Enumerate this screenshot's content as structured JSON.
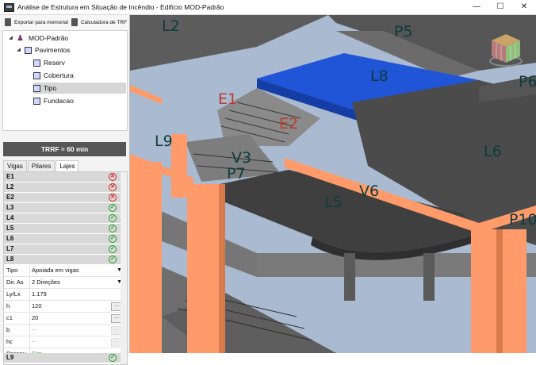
{
  "window": {
    "title": "Análise de Estrutura em Situação de Incêndio - Edifício MOD-Padrão",
    "controls": [
      "—",
      "☐",
      "✕"
    ]
  },
  "toolbar": {
    "export_label": "Exportar para memorial",
    "trrf_calc_label": "Calculadora de TRF"
  },
  "tree": {
    "root": "MOD-Padrão",
    "group": "Pavimentos",
    "items": [
      "Reserv",
      "Cobertura",
      "Tipo",
      "Fundacao"
    ],
    "selected": "Tipo"
  },
  "trrf_banner": "TRRF = 60 min",
  "tabs": [
    "Vigas",
    "Pilares",
    "Lajes"
  ],
  "active_tab": "Lajes",
  "slabs": [
    {
      "id": "E1",
      "status": "fail"
    },
    {
      "id": "L2",
      "status": "fail"
    },
    {
      "id": "E2",
      "status": "fail"
    },
    {
      "id": "L3",
      "status": "ok"
    },
    {
      "id": "L4",
      "status": "ok"
    },
    {
      "id": "L5",
      "status": "ok"
    },
    {
      "id": "L6",
      "status": "ok"
    },
    {
      "id": "L7",
      "status": "ok"
    },
    {
      "id": "L8",
      "status": "ok",
      "expanded": true
    }
  ],
  "l8_props": {
    "tipo_label": "Tipo",
    "tipo_value": "Apoiada em vigas",
    "dir_label": "Dir. As",
    "dir_value": "2 Direções",
    "lylx_label": "Ly/Lx",
    "lylx_value": "1.179",
    "h_label": "h",
    "h_value": "120",
    "c1_label": "c1",
    "c1_value": "20",
    "b_label": "b",
    "b_value": "--",
    "hc_label": "hc",
    "hc_value": "--",
    "passou_label": "Passou",
    "passou_value": "Sim"
  },
  "last_row": {
    "id": "L9",
    "status": "ok"
  },
  "viewport_labels": {
    "l2": "L2",
    "p5": "P5",
    "l8": "L8",
    "p6": "P6",
    "e1": "E1",
    "e2": "E2",
    "l9": "L9",
    "v3": "V3",
    "p7": "P7",
    "l6": "L6",
    "v6": "V6",
    "l5": "L5",
    "p10": "P10"
  },
  "colors": {
    "slab_selected": "#1f55d6",
    "column": "#ff9b6a",
    "slab_dark": "#4b4b4b",
    "background": "#a9bad1",
    "label_red": "#c0392b",
    "label_dark": "#0e3b3b"
  }
}
